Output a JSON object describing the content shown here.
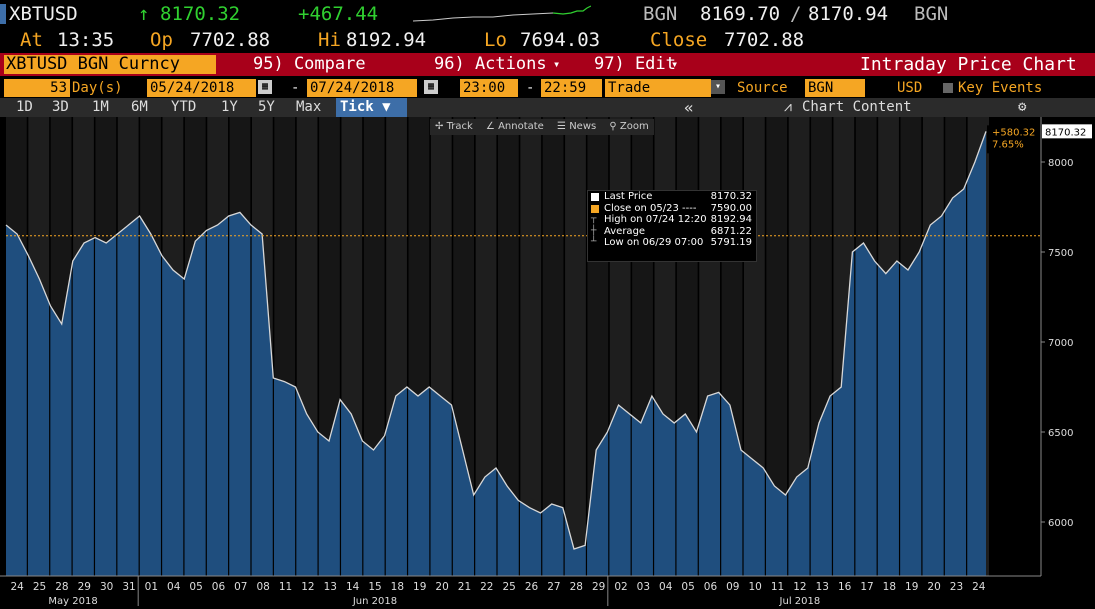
{
  "header": {
    "ticker": "XBTUSD",
    "arrow": "↑",
    "last": "8170.32",
    "change": "+467.44",
    "source1": "BGN",
    "bid": "8169.70",
    "slash": "/",
    "ask": "8170.94",
    "source2": "BGN",
    "at_label": "At",
    "time": "13:35",
    "op_label": "Op",
    "open": "7702.88",
    "hi_label": "Hi",
    "high": "8192.94",
    "lo_label": "Lo",
    "low": "7694.03",
    "close_label": "Close",
    "close": "7702.88"
  },
  "toolbar": {
    "security": "XBTUSD BGN Curncy",
    "compare": "95) Compare",
    "actions": "96) Actions",
    "edit": "97) Edit",
    "chart_title": "Intraday Price Chart"
  },
  "daterow": {
    "days_value": "53",
    "days_label": "Day(s)",
    "start_date": "05/24/2018",
    "dash1": "-",
    "end_date": "07/24/2018",
    "start_time": "23:00",
    "dash2": "-",
    "end_time": "22:59",
    "field": "Trade",
    "source_label": "Source",
    "source_value": "BGN",
    "currency": "USD",
    "key_events": "Key Events"
  },
  "periods": [
    "1D",
    "3D",
    "1M",
    "6M",
    "YTD",
    "1Y",
    "5Y",
    "Max"
  ],
  "tick_label": "Tick ▼",
  "collapse_label": "«",
  "chart_content_label": "Chart Content",
  "chart_tools": {
    "track": "Track",
    "annotate": "Annotate",
    "news": "News",
    "zoom": "Zoom"
  },
  "legend": [
    {
      "label": "Last Price",
      "value": "8170.32"
    },
    {
      "label": "Close on 05/23 ----",
      "value": "7590.00"
    },
    {
      "label": "High on 07/24 12:20",
      "value": "8192.94"
    },
    {
      "label": "Average",
      "value": "6871.22"
    },
    {
      "label": "Low on 06/29 07:00",
      "value": "5791.19"
    }
  ],
  "colors": {
    "amber": "#f5a623",
    "bar_red": "#a8001a",
    "area_blue": "#1f4e7e",
    "up_green": "#30d030"
  },
  "chart_data": {
    "type": "area",
    "ylim": [
      5700,
      8250
    ],
    "y_ticks": [
      6000,
      6500,
      7000,
      7500,
      8000
    ],
    "x_labels": [
      "24",
      "25",
      "28",
      "29",
      "30",
      "31",
      "01",
      "04",
      "05",
      "06",
      "07",
      "08",
      "11",
      "12",
      "13",
      "14",
      "15",
      "18",
      "19",
      "20",
      "21",
      "22",
      "25",
      "26",
      "27",
      "28",
      "29",
      "02",
      "03",
      "04",
      "05",
      "06",
      "09",
      "10",
      "11",
      "12",
      "13",
      "16",
      "17",
      "18",
      "19",
      "20",
      "23",
      "24"
    ],
    "month_labels": [
      "May 2018",
      "Jun 2018",
      "Jul 2018"
    ],
    "reference_close": 7590,
    "last_value": "8170.32",
    "change_label": "+580.32",
    "change_pct": "7.65%",
    "y": [
      7650,
      7600,
      7480,
      7350,
      7200,
      7100,
      7450,
      7550,
      7580,
      7550,
      7600,
      7650,
      7700,
      7600,
      7480,
      7400,
      7350,
      7560,
      7620,
      7650,
      7700,
      7720,
      7650,
      7600,
      6800,
      6780,
      6750,
      6600,
      6500,
      6450,
      6680,
      6600,
      6450,
      6400,
      6480,
      6700,
      6750,
      6700,
      6750,
      6700,
      6650,
      6400,
      6150,
      6250,
      6300,
      6200,
      6120,
      6080,
      6050,
      6100,
      6080,
      5850,
      5870,
      6400,
      6500,
      6650,
      6600,
      6550,
      6700,
      6600,
      6550,
      6600,
      6500,
      6700,
      6720,
      6650,
      6400,
      6350,
      6300,
      6200,
      6150,
      6250,
      6300,
      6550,
      6700,
      6750,
      7500,
      7550,
      7450,
      7380,
      7450,
      7400,
      7500,
      7650,
      7700,
      7800,
      7850,
      8000,
      8170
    ]
  }
}
